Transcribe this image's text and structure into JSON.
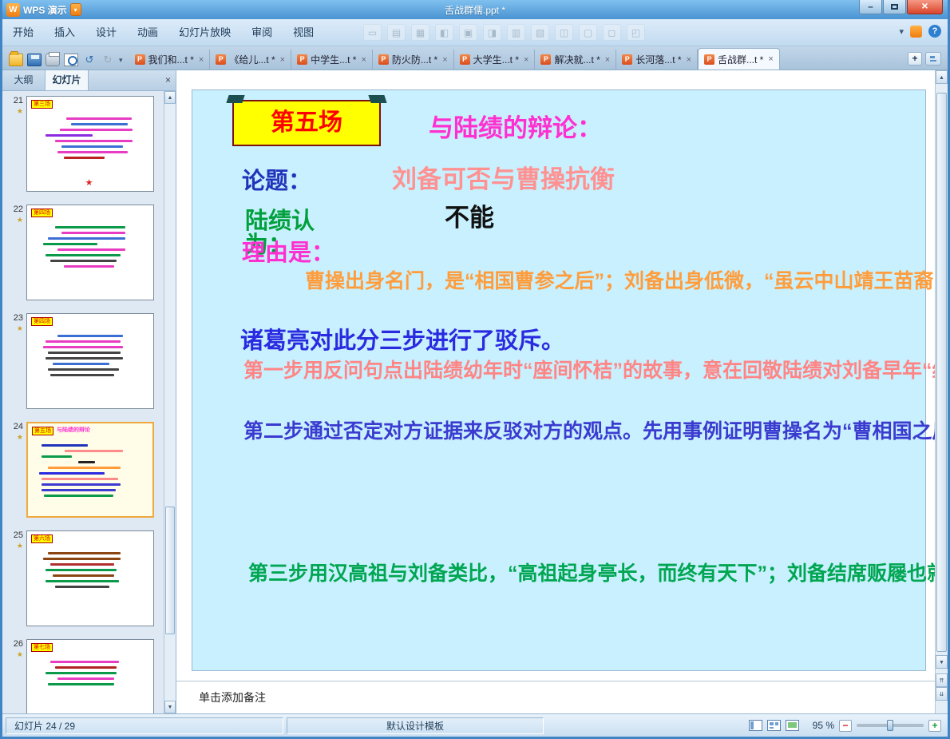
{
  "titlebar": {
    "app_name": "WPS 演示",
    "doc_title": "舌战群儒.ppt *"
  },
  "icons": {
    "close": "×",
    "min": "–",
    "dropdown": "▾",
    "collapse": "▾",
    "undo": "↺",
    "redo": "↻",
    "star": "★",
    "burst": "★",
    "scroll_up": "▲",
    "scroll_down": "▼",
    "prev_slide": "⇈",
    "next_slide": "⇊",
    "help": "?",
    "new_tab": "+",
    "zoom_minus": "−",
    "zoom_plus": "+",
    "ppt_file": "P",
    "logo": "W",
    "ghost_tools": [
      "▭",
      "▤",
      "▦",
      "◧",
      "▣",
      "◨",
      "▥",
      "▧",
      "◫",
      "▢",
      "◻",
      "◰"
    ]
  },
  "menu_tabs": [
    "开始",
    "插入",
    "设计",
    "动画",
    "幻灯片放映",
    "审阅",
    "视图"
  ],
  "doc_tabs": [
    {
      "label": "我们和...t *",
      "active": false
    },
    {
      "label": "《给儿...t *",
      "active": false
    },
    {
      "label": "中学生...t *",
      "active": false
    },
    {
      "label": "防火防...t *",
      "active": false
    },
    {
      "label": "大学生...t *",
      "active": false
    },
    {
      "label": "解决就...t *",
      "active": false
    },
    {
      "label": "长河落...t *",
      "active": false
    },
    {
      "label": "舌战群...t *",
      "active": true
    }
  ],
  "panel": {
    "outline_tab": "大纲",
    "slides_tab": "幻灯片"
  },
  "thumbnails": [
    {
      "num": "21",
      "banner": "第三场",
      "star": true,
      "selected": false,
      "lines": [
        {
          "c": "#e83cc3",
          "w": 55,
          "i": 30
        },
        {
          "c": "#3b6fd4",
          "w": 48,
          "i": 34
        },
        {
          "c": "#e83cc3",
          "w": 62,
          "i": 24
        },
        {
          "c": "#8a2be2",
          "w": 40,
          "i": 12
        },
        {
          "c": "#e83cc3",
          "w": 66,
          "i": 20
        },
        {
          "c": "#3b6fd4",
          "w": 52,
          "i": 26
        },
        {
          "c": "#e83cc3",
          "w": 60,
          "i": 22
        },
        {
          "c": "#bb2222",
          "w": 34,
          "i": 28
        }
      ]
    },
    {
      "num": "22",
      "banner": "第四场",
      "star": false,
      "selected": false,
      "lines": [
        {
          "c": "#0a9a4a",
          "w": 60,
          "i": 20
        },
        {
          "c": "#e83cc3",
          "w": 54,
          "i": 26
        },
        {
          "c": "#3b6fd4",
          "w": 66,
          "i": 14
        },
        {
          "c": "#0a9a4a",
          "w": 46,
          "i": 10
        },
        {
          "c": "#e83cc3",
          "w": 58,
          "i": 22
        },
        {
          "c": "#0a9a4a",
          "w": 64,
          "i": 12
        },
        {
          "c": "#444444",
          "w": 56,
          "i": 16
        },
        {
          "c": "#e83cc3",
          "w": 42,
          "i": 28
        }
      ]
    },
    {
      "num": "23",
      "banner": "第四场",
      "star": false,
      "selected": false,
      "lines": [
        {
          "c": "#3b6fd4",
          "w": 56,
          "i": 22
        },
        {
          "c": "#e83cc3",
          "w": 64,
          "i": 12
        },
        {
          "c": "#e83cc3",
          "w": 68,
          "i": 10
        },
        {
          "c": "#444444",
          "w": 62,
          "i": 14
        },
        {
          "c": "#444444",
          "w": 66,
          "i": 12
        },
        {
          "c": "#3b6fd4",
          "w": 48,
          "i": 18
        },
        {
          "c": "#444444",
          "w": 60,
          "i": 14
        },
        {
          "c": "#444444",
          "w": 54,
          "i": 16
        }
      ]
    },
    {
      "num": "24",
      "banner": "第五场",
      "heading": "与陆绩的辩论",
      "heading_color": "#ff2fd0",
      "star": false,
      "selected": true,
      "lines": [
        {
          "c": "#2233bb",
          "w": 40,
          "i": 8
        },
        {
          "c": "#ff8a8a",
          "w": 50,
          "i": 28
        },
        {
          "c": "#0a9a4a",
          "w": 26,
          "i": 8
        },
        {
          "c": "#222222",
          "w": 14,
          "i": 40
        },
        {
          "c": "#ff9d3c",
          "w": 62,
          "i": 14
        },
        {
          "c": "#2a2ae0",
          "w": 56,
          "i": 6
        },
        {
          "c": "#ff8a8a",
          "w": 66,
          "i": 8
        },
        {
          "c": "#3b3bd0",
          "w": 68,
          "i": 8
        },
        {
          "c": "#3b3bd0",
          "w": 64,
          "i": 8
        },
        {
          "c": "#0a9a4a",
          "w": 60,
          "i": 10
        }
      ]
    },
    {
      "num": "25",
      "banner": "第六场",
      "star": false,
      "selected": false,
      "lines": [
        {
          "c": "#8b4513",
          "w": 62,
          "i": 14
        },
        {
          "c": "#8b4513",
          "w": 66,
          "i": 10
        },
        {
          "c": "#b03030",
          "w": 54,
          "i": 16
        },
        {
          "c": "#0a9a4a",
          "w": 60,
          "i": 12
        },
        {
          "c": "#8b4513",
          "w": 52,
          "i": 18
        },
        {
          "c": "#0a9a4a",
          "w": 62,
          "i": 12
        },
        {
          "c": "#444444",
          "w": 46,
          "i": 20
        }
      ]
    },
    {
      "num": "26",
      "banner": "第七场",
      "star": false,
      "selected": false,
      "lines": [
        {
          "c": "#e83cc3",
          "w": 58,
          "i": 16
        },
        {
          "c": "#b22222",
          "w": 52,
          "i": 20
        },
        {
          "c": "#0a9a4a",
          "w": 60,
          "i": 12
        },
        {
          "c": "#e83cc3",
          "w": 48,
          "i": 22
        },
        {
          "c": "#0a9a4a",
          "w": 56,
          "i": 14
        }
      ]
    }
  ],
  "slide": {
    "scene_banner": "第五场",
    "title": "与陆绩的辩论：",
    "topic_label": "论题：",
    "topic_value": "刘备可否与曹操抗衡",
    "debater_line": "陆绩认",
    "debater_wrap": "为：",
    "stance": "不能",
    "reason_label": "理由是：",
    "quote": "曹操出身名门，是“相国曹参之后”；刘备出身低微，“虽云中山靖王苗裔，却无可稽考，眼见只是织席贩屦之夫耳”。",
    "heading": "诸葛亮对此分三步进行了驳斥。",
    "step1": "第一步用反问句点出陆绩幼年时“座间怀桔”的故事，意在回敬陆绩对刘备早年“织席贩屦”的讥讽。",
    "step2": "第二步通过否定对方证据来反驳对方的观点。先用事例证明曹操名为“曹相国之后”实为“曹氏之贼子”，再指出“刘豫州虽云中山靖王苗裔， 却无可查考”的说法与“刘豫州堂堂帝胄，当今皇帝，按谱赐爵”的事实相矛盾，驳斥了刘备低微的说法。这样，构成对方证据的两个要件就被否定了，对方的观点也就不攻自破了。",
    "step3": "第三步用汉高祖与刘备类比，“高祖起身亭长，而终有天下”；刘备结席贩屦也就不见得无法与曹操抗衡，从而完全驳倒了对方。"
  },
  "notes": {
    "placeholder": "单击添加备注"
  },
  "status": {
    "slide_position": "幻灯片 24 / 29",
    "template_name": "默认设计模板",
    "zoom_value": "95 %"
  },
  "colors": {
    "slide_bg": "#c8f0fe",
    "banner_bg": "#ffff00",
    "banner_text": "#ff0000",
    "title": "#ff2fd0",
    "topic_label": "#2233bb",
    "topic_value": "#ff9191",
    "stance_green": "#00a03c",
    "reason": "#ff2fd0",
    "quote": "#ff9d3c",
    "heading": "#2a2ae0",
    "step1": "#ff8585",
    "step2": "#3b3bd0",
    "step3": "#00a651"
  }
}
